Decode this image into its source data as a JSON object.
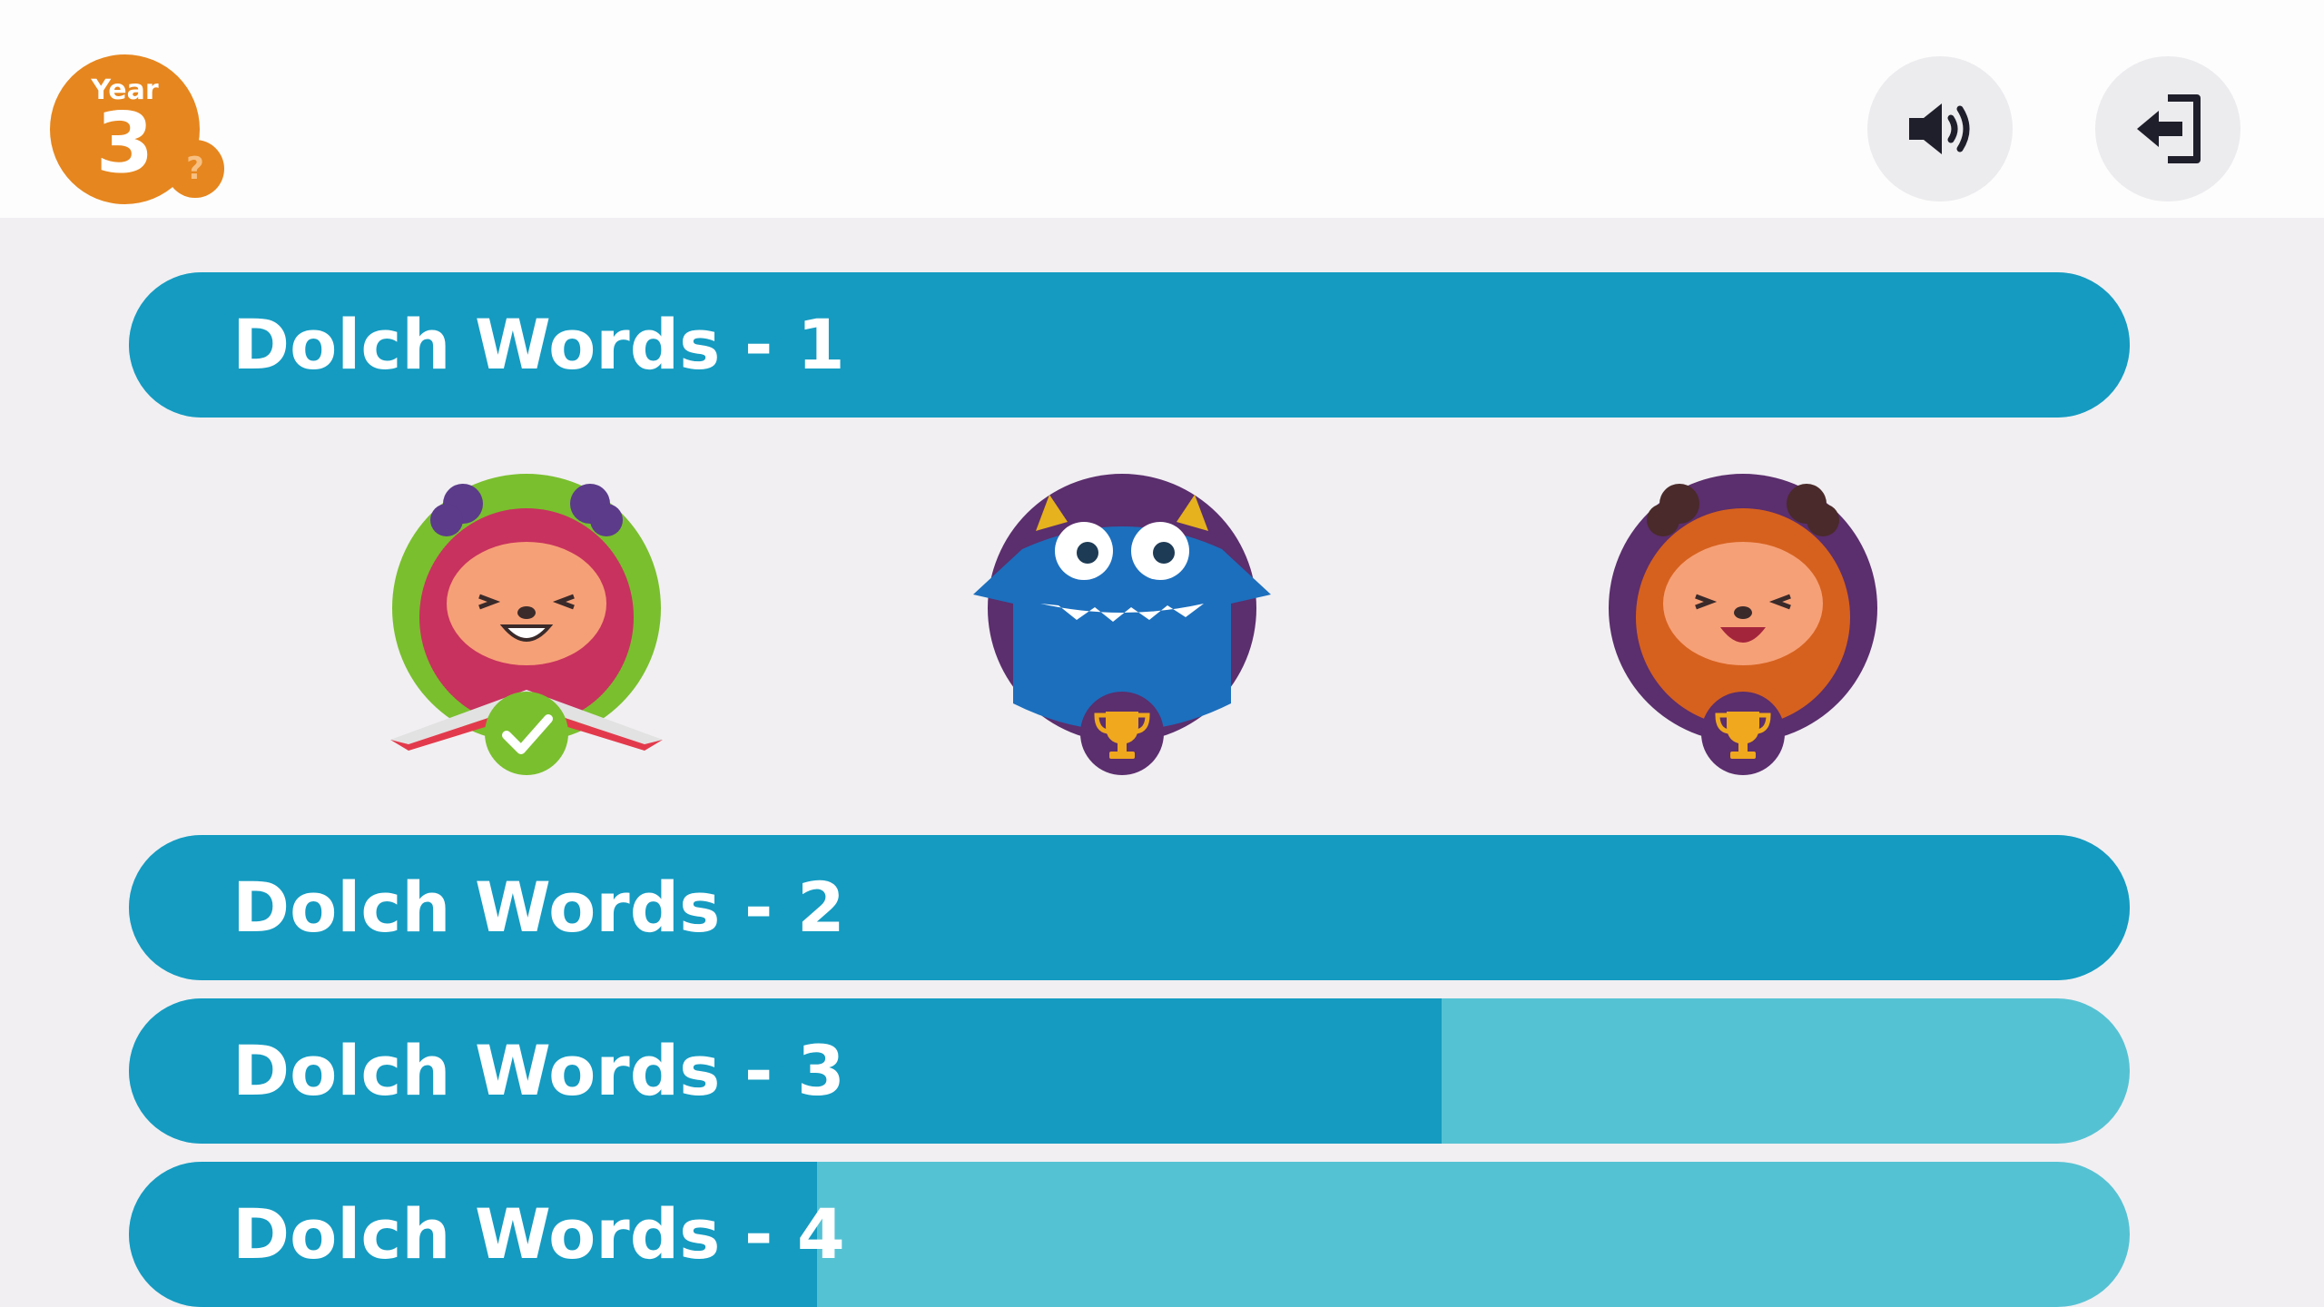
{
  "header": {
    "year_label": "Year",
    "year_number": "3",
    "help_symbol": "?",
    "sound_icon": "speaker-volume-icon",
    "exit_icon": "exit-arrow-icon"
  },
  "levels": [
    {
      "title": "Dolch Words - 1",
      "progress": 1.0
    },
    {
      "title": "Dolch Words - 2",
      "progress": 1.0
    },
    {
      "title": "Dolch Words - 3",
      "progress": 0.656
    },
    {
      "title": "Dolch Words - 4",
      "progress": 0.344
    }
  ],
  "activities": [
    {
      "character": "pink-furry-monster-reading-book",
      "status": "completed",
      "badge_icon": "checkmark-icon"
    },
    {
      "character": "blue-horned-monster",
      "status": "not-started",
      "badge_icon": "trophy-icon"
    },
    {
      "character": "orange-furry-monster",
      "status": "not-started",
      "badge_icon": "trophy-icon"
    }
  ],
  "colors": {
    "accent_orange": "#e6861e",
    "bar_fill": "#159bc1",
    "bar_track": "#55c2d3",
    "check_green": "#7abf2e",
    "badge_purple": "#5b2e6d"
  }
}
